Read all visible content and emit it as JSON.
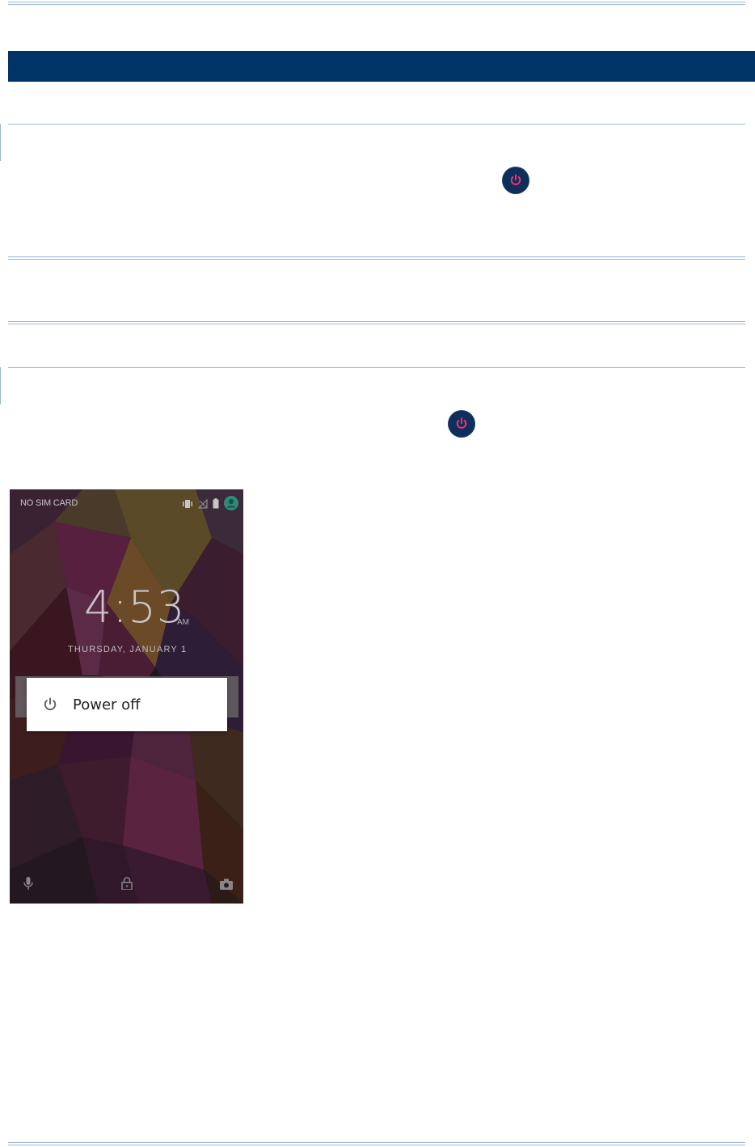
{
  "page": {
    "background": "#ffffff",
    "banner_color": "#003366",
    "rule_color": "#9db7d6"
  },
  "icons": {
    "inline_power": "power-icon"
  },
  "phone": {
    "status": {
      "carrier": "NO SIM CARD",
      "icons": [
        "vibrate-icon",
        "no-signal-icon",
        "battery-icon",
        "user-avatar-icon"
      ]
    },
    "clock": {
      "time": "4:53",
      "ampm": "AM",
      "date": "THURSDAY, JANUARY 1"
    },
    "dialog": {
      "icon": "power-icon",
      "label": "Power off"
    },
    "bottom_bar": [
      "microphone-icon",
      "lock-icon",
      "camera-icon"
    ]
  }
}
